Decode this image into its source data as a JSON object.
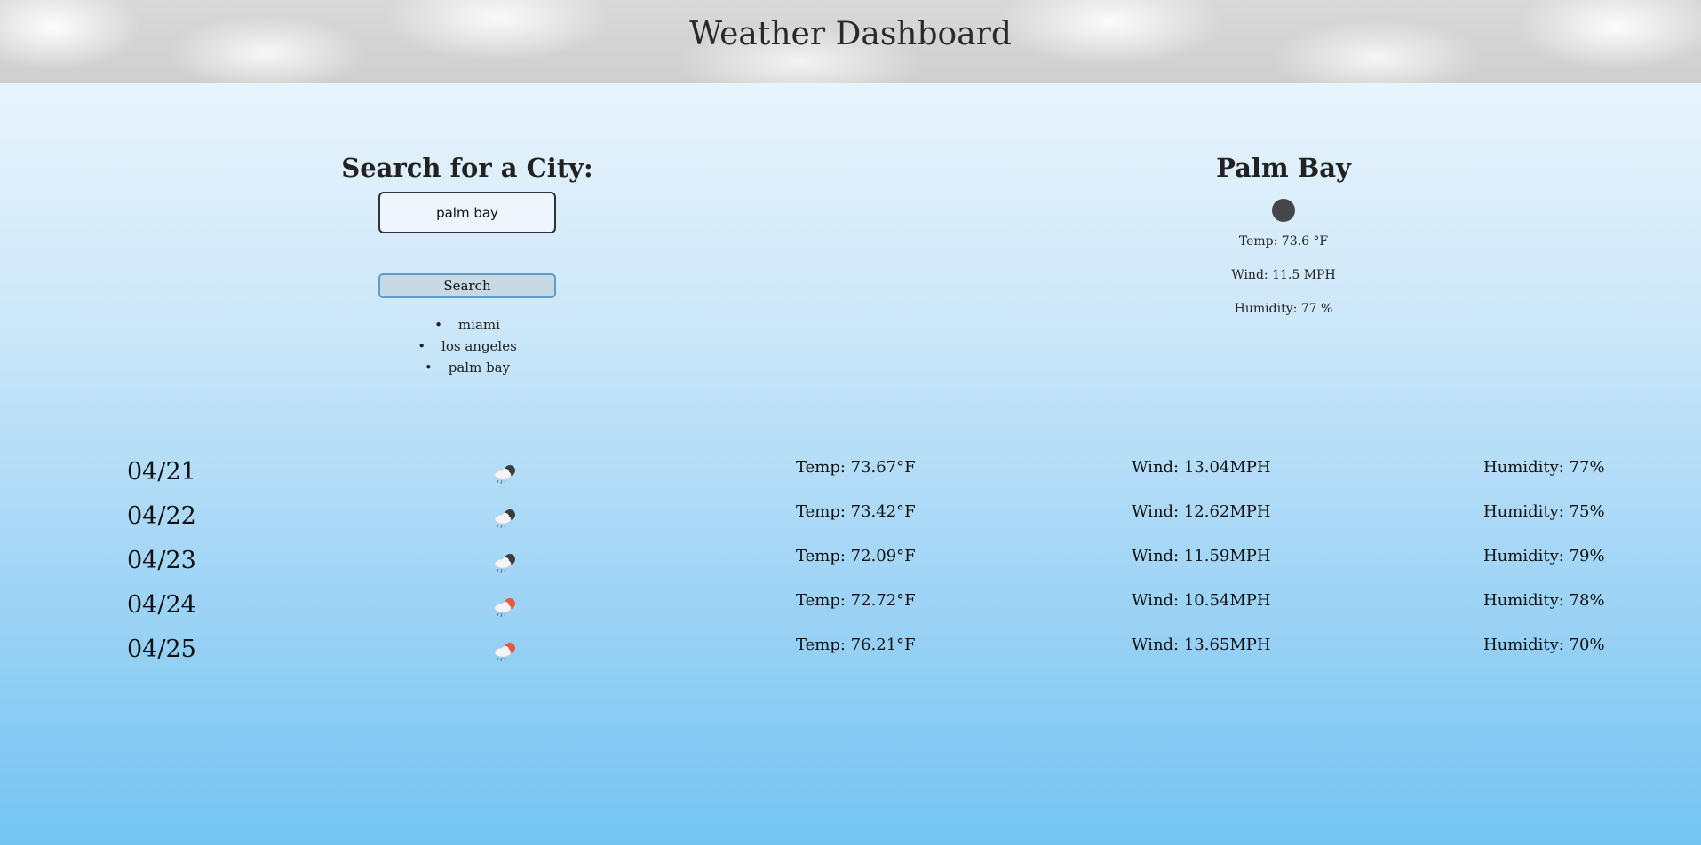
{
  "header": {
    "title": "Weather Dashboard"
  },
  "search": {
    "label": "Search for a City:",
    "input_value": "palm bay",
    "button_label": "Search",
    "history": [
      "miami",
      "los angeles",
      "palm bay"
    ]
  },
  "current": {
    "city": "Palm Bay",
    "icon": "cloud-icon",
    "temp": "Temp: 73.6 °F",
    "wind": "Wind: 11.5 MPH",
    "humidity": "Humidity: 77 %"
  },
  "forecast": [
    {
      "date": "04/21",
      "icon": "rain-night-icon",
      "temp": "Temp: 73.67°F",
      "wind": "Wind: 13.04MPH",
      "humidity": "Humidity: 77%"
    },
    {
      "date": "04/22",
      "icon": "rain-night-icon",
      "temp": "Temp: 73.42°F",
      "wind": "Wind: 12.62MPH",
      "humidity": "Humidity: 75%"
    },
    {
      "date": "04/23",
      "icon": "rain-night-icon",
      "temp": "Temp: 72.09°F",
      "wind": "Wind: 11.59MPH",
      "humidity": "Humidity: 79%"
    },
    {
      "date": "04/24",
      "icon": "rain-day-icon",
      "temp": "Temp: 72.72°F",
      "wind": "Wind: 10.54MPH",
      "humidity": "Humidity: 78%"
    },
    {
      "date": "04/25",
      "icon": "rain-day-icon",
      "temp": "Temp: 76.21°F",
      "wind": "Wind: 13.65MPH",
      "humidity": "Humidity: 70%"
    }
  ],
  "colors": {
    "sun": "#e8593d",
    "moon": "#3c3c3c",
    "cloud": "#f4f4f4",
    "rain": "#5a6e80"
  }
}
